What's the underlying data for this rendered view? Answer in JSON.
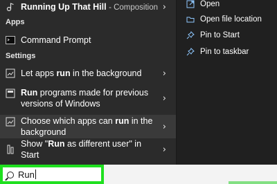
{
  "top_result": {
    "title": "Running Up That Hill",
    "subtitle": "Composition"
  },
  "sections": {
    "apps": "Apps",
    "settings": "Settings"
  },
  "apps": [
    {
      "label": "Command Prompt"
    }
  ],
  "settings": [
    {
      "pre": "Let apps ",
      "bold": "run",
      "post": " in the background"
    },
    {
      "pre": "",
      "bold": "Run",
      "post": " programs made for previous versions of Windows"
    },
    {
      "pre": "Choose which apps can ",
      "bold": "run",
      "post": " in the background"
    },
    {
      "pre": "Show \"",
      "bold": "Run",
      "post": " as different user\" in Start"
    }
  ],
  "right_actions": [
    {
      "label": "Open",
      "icon": "open-icon"
    },
    {
      "label": "Open file location",
      "icon": "folder-icon"
    },
    {
      "label": "Pin to Start",
      "icon": "pin-icon"
    },
    {
      "label": "Pin to taskbar",
      "icon": "pin-icon"
    }
  ],
  "search": {
    "value": "Run"
  }
}
